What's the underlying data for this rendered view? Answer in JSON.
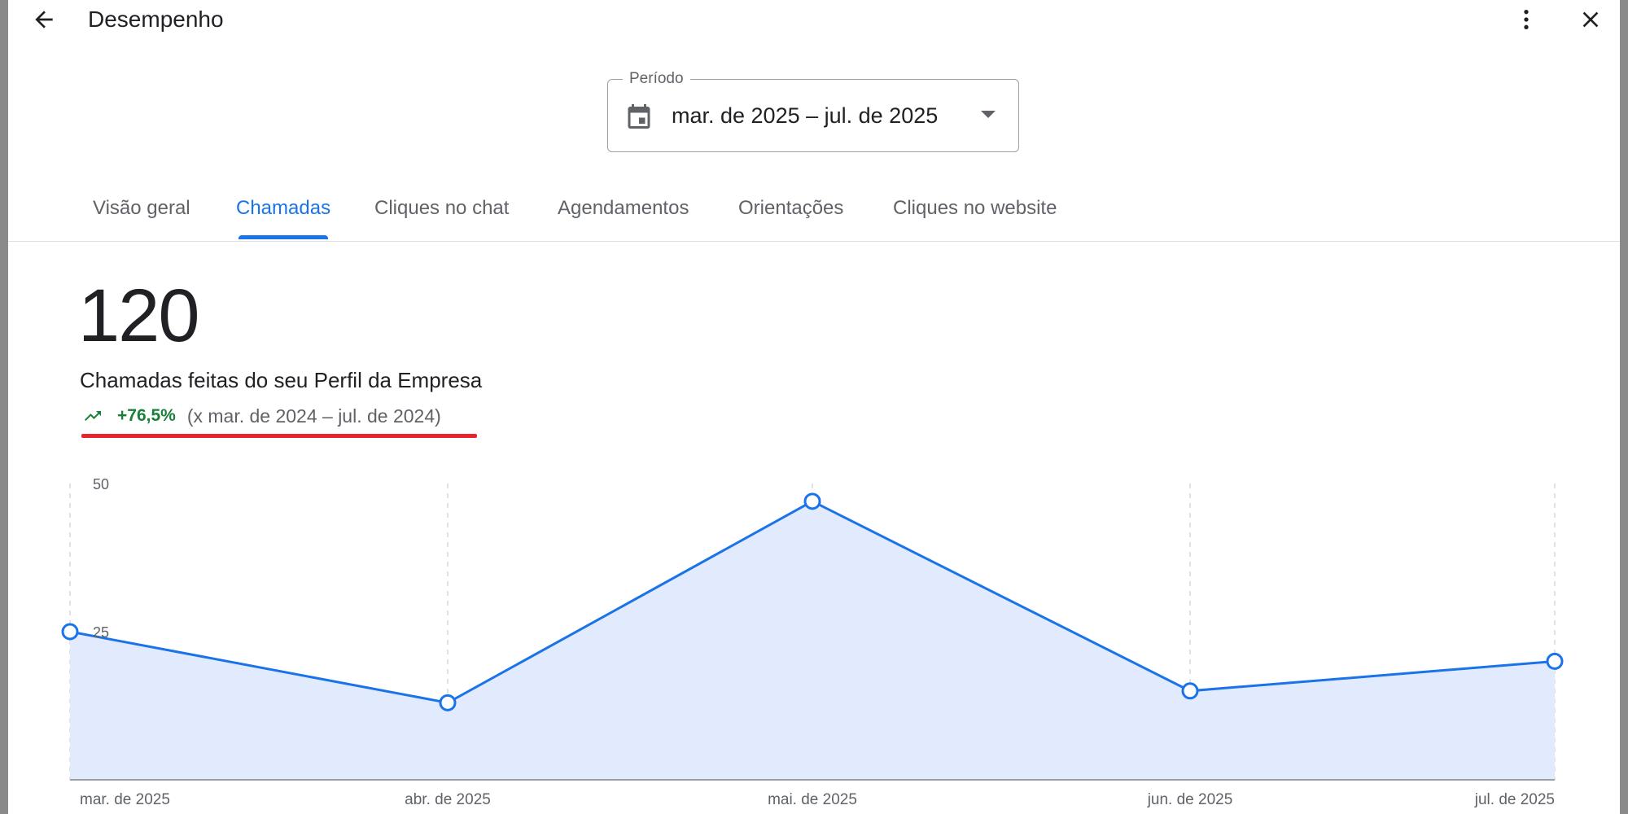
{
  "header": {
    "title": "Desempenho",
    "back_icon": "arrow-back-icon",
    "more_icon": "more-vert-icon",
    "close_icon": "close-icon"
  },
  "period": {
    "label": "Período",
    "value": "mar. de 2025 – jul. de 2025",
    "icon": "calendar-icon"
  },
  "tabs": [
    {
      "label": "Visão geral",
      "active": false
    },
    {
      "label": "Chamadas",
      "active": true
    },
    {
      "label": "Cliques no chat",
      "active": false
    },
    {
      "label": "Agendamentos",
      "active": false
    },
    {
      "label": "Orientações",
      "active": false
    },
    {
      "label": "Cliques no website",
      "active": false
    }
  ],
  "metric": {
    "value": "120",
    "label": "Chamadas feitas do seu Perfil da Empresa",
    "delta": "+76,5%",
    "compare": "(x mar. de 2024 – jul. de 2024)",
    "delta_color": "#188038",
    "trend_icon": "trending-up-icon"
  },
  "colors": {
    "accent": "#1a73e8",
    "area_fill": "#e1ebfd",
    "highlight_underline": "#e8242a"
  },
  "chart_data": {
    "type": "area",
    "categories": [
      "mar. de 2025",
      "abr. de 2025",
      "mai. de 2025",
      "jun. de 2025",
      "jul. de 2025"
    ],
    "values": [
      25,
      13,
      47,
      15,
      20
    ],
    "yticks": [
      25,
      50
    ],
    "ylim": [
      0,
      50
    ],
    "grid": "vertical-dashed"
  }
}
